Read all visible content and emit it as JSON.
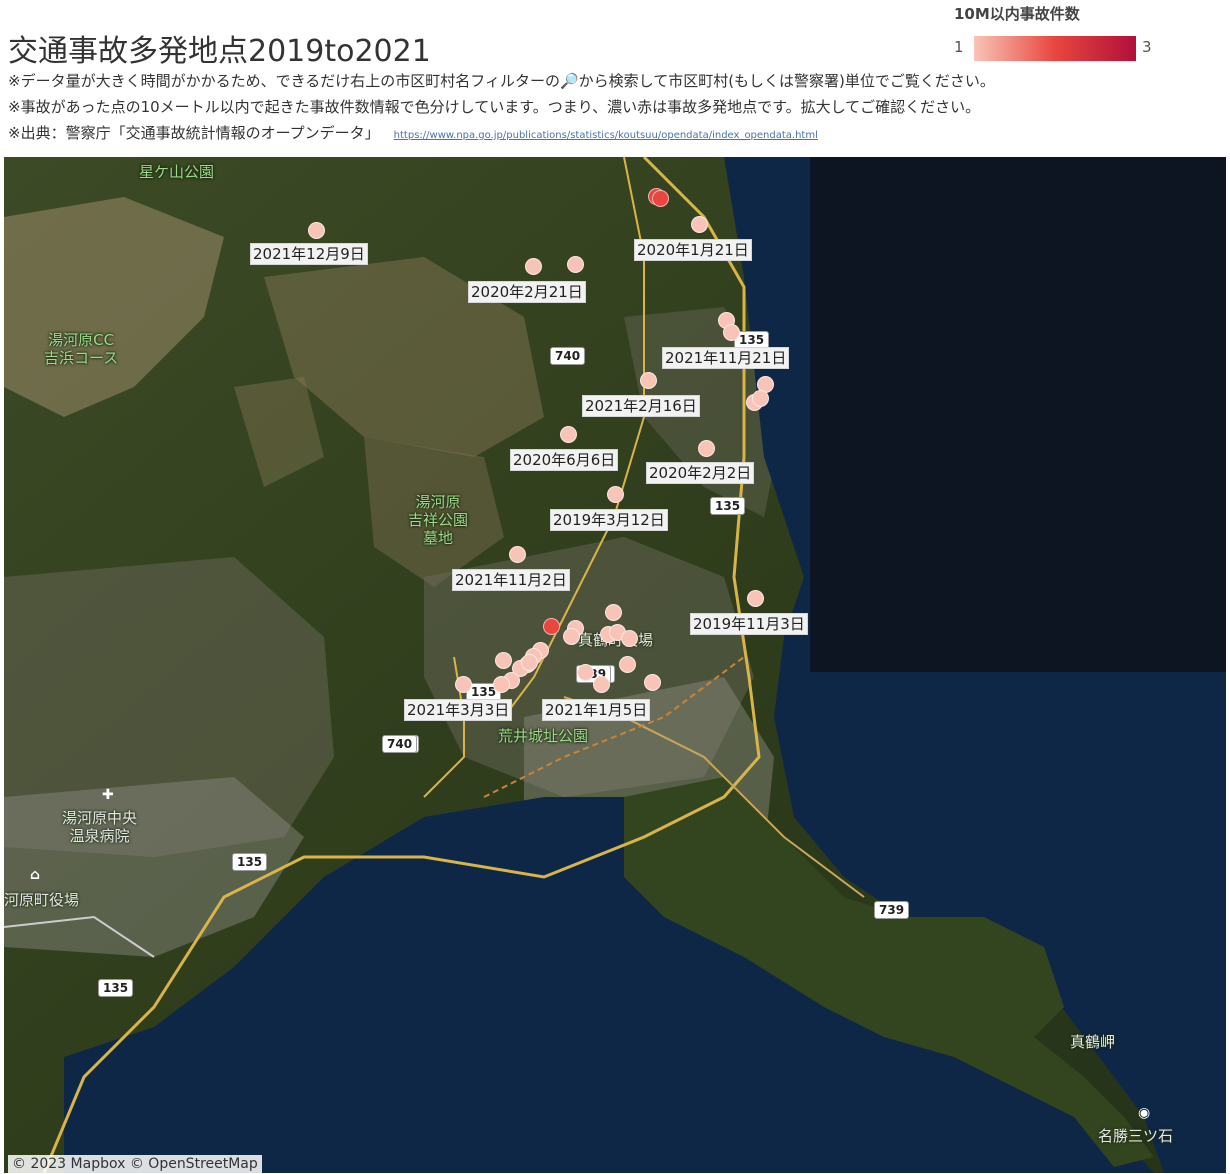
{
  "header": {
    "title": "交通事故多発地点2019to2021",
    "note1": "※データ量が大きく時間がかかるため、できるだけ右上の市区町村名フィルターの🔎から検索して市区町村(もしくは警察署)単位でご覧ください。",
    "note2": "※事故があった点の10メートル以内で起きた事故件数情報で色分けしています。つまり、濃い赤は事故多発地点です。拡大してご確認ください。",
    "note3": "※出典：警察庁「交通事故統計情報のオープンデータ」",
    "source_url": "https://www.npa.go.jp/publications/statistics/koutsuu/opendata/index_opendata.html"
  },
  "legend": {
    "title": "10M以内事故件数",
    "min": "1",
    "max": "3",
    "color_low": "#f9c4b8",
    "color_mid": "#e8463f",
    "color_high": "#b0103a"
  },
  "map": {
    "place_labels": {
      "hoshigayama": "星ケ山公園",
      "golf_course": "湯河原CC\n吉浜コース",
      "kissho_park": "湯河原\n吉祥公園\n墓地",
      "hospital": "湯河原中央\n温泉病院",
      "town_hall": "河原町役場",
      "arai_castle": "荒井城址公園",
      "station_area": "真鶴町役場",
      "manazuru_cape": "真鶴岬",
      "mitsuishi": "名勝三ツ石"
    },
    "road_shields": [
      "740",
      "135",
      "135",
      "740",
      "739",
      "135",
      "135",
      "740",
      "135",
      "739",
      "135"
    ],
    "date_labels": [
      "2021年12月9日",
      "2020年1月21日",
      "2020年2月21日",
      "2021年11月21日",
      "2021年2月16日",
      "2020年6月6日",
      "2020年2月2日",
      "2019年3月12日",
      "2021年11月2日",
      "2019年11月3日",
      "2021年3月3日",
      "2021年1月5日"
    ],
    "accidents": [
      {
        "count": 1
      },
      {
        "count": 2
      },
      {
        "count": 2
      },
      {
        "count": 1
      },
      {
        "count": 1
      },
      {
        "count": 1
      },
      {
        "count": 1
      },
      {
        "count": 1
      },
      {
        "count": 1
      },
      {
        "count": 1
      },
      {
        "count": 1
      },
      {
        "count": 1
      },
      {
        "count": 1
      },
      {
        "count": 1
      },
      {
        "count": 1
      },
      {
        "count": 1
      },
      {
        "count": 1
      },
      {
        "count": 2
      },
      {
        "count": 1
      },
      {
        "count": 1
      },
      {
        "count": 1
      },
      {
        "count": 1
      },
      {
        "count": 1
      },
      {
        "count": 1
      },
      {
        "count": 1
      },
      {
        "count": 1
      },
      {
        "count": 1
      },
      {
        "count": 1
      },
      {
        "count": 1
      },
      {
        "count": 1
      },
      {
        "count": 1
      },
      {
        "count": 1
      },
      {
        "count": 1
      },
      {
        "count": 1
      },
      {
        "count": 1
      },
      {
        "count": 1
      },
      {
        "count": 1
      }
    ],
    "attribution": {
      "mapbox": "© 2023 Mapbox",
      "osm": "© OpenStreetMap"
    }
  }
}
